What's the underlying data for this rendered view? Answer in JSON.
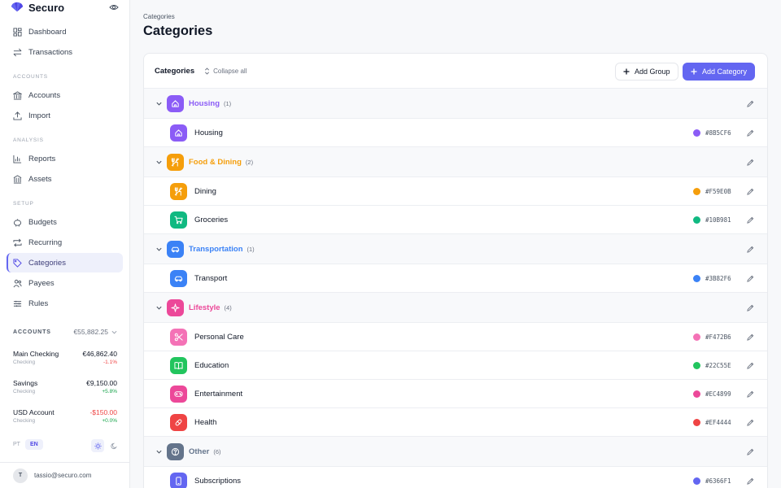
{
  "app": {
    "name": "Securo",
    "brand_color": "#6366f1"
  },
  "nav": {
    "top": [
      {
        "label": "Dashboard",
        "icon": "dashboard-icon"
      },
      {
        "label": "Transactions",
        "icon": "transactions-icon"
      }
    ],
    "accounts_label": "ACCOUNTS",
    "accounts": [
      {
        "label": "Accounts",
        "icon": "bank-icon"
      },
      {
        "label": "Import",
        "icon": "upload-icon"
      }
    ],
    "analysis_label": "ANALYSIS",
    "analysis": [
      {
        "label": "Reports",
        "icon": "chart-icon"
      },
      {
        "label": "Assets",
        "icon": "building-icon"
      }
    ],
    "setup_label": "SETUP",
    "setup": [
      {
        "label": "Budgets",
        "icon": "piggy-icon"
      },
      {
        "label": "Recurring",
        "icon": "repeat-icon"
      },
      {
        "label": "Categories",
        "icon": "tag-icon",
        "active": true
      },
      {
        "label": "Payees",
        "icon": "people-icon"
      },
      {
        "label": "Rules",
        "icon": "sliders-icon"
      }
    ]
  },
  "accounts_summary": {
    "label": "ACCOUNTS",
    "total": "€55,882.25",
    "items": [
      {
        "name": "Main Checking",
        "type": "Checking",
        "balance": "€46,862.40",
        "change": "-1.1%",
        "trend": "neg"
      },
      {
        "name": "Savings",
        "type": "Checking",
        "balance": "€9,150.00",
        "change": "+5.8%",
        "trend": "pos"
      },
      {
        "name": "USD Account",
        "type": "Checking",
        "balance": "-$150.00",
        "change": "+0.0%",
        "trend": "pos"
      }
    ]
  },
  "language": {
    "options": [
      "PT",
      "EN"
    ],
    "selected": "EN"
  },
  "user": {
    "initial": "T",
    "email": "tassio@securo.com"
  },
  "page": {
    "breadcrumb": "Categories",
    "title": "Categories"
  },
  "toolbar": {
    "title": "Categories",
    "collapse_label": "Collapse all",
    "add_group_label": "Add Group",
    "add_category_label": "Add Category"
  },
  "groups": [
    {
      "name": "Housing",
      "count": "(1)",
      "color": "#8B5CF6",
      "icon": "home-icon",
      "items": [
        {
          "name": "Housing",
          "hex": "#8B5CF6",
          "icon": "home-icon"
        }
      ]
    },
    {
      "name": "Food & Dining",
      "count": "(2)",
      "color": "#F59E0B",
      "icon": "utensils-icon",
      "items": [
        {
          "name": "Dining",
          "hex": "#F59E0B",
          "icon": "utensils-icon"
        },
        {
          "name": "Groceries",
          "hex": "#10B981",
          "icon": "cart-icon"
        }
      ]
    },
    {
      "name": "Transportation",
      "count": "(1)",
      "color": "#3B82F6",
      "icon": "car-icon",
      "items": [
        {
          "name": "Transport",
          "hex": "#3B82F6",
          "icon": "car-icon"
        }
      ]
    },
    {
      "name": "Lifestyle",
      "count": "(4)",
      "color": "#EC4899",
      "icon": "sparkles-icon",
      "items": [
        {
          "name": "Personal Care",
          "hex": "#F472B6",
          "icon": "scissors-icon"
        },
        {
          "name": "Education",
          "hex": "#22C55E",
          "icon": "book-icon"
        },
        {
          "name": "Entertainment",
          "hex": "#EC4899",
          "icon": "gamepad-icon"
        },
        {
          "name": "Health",
          "hex": "#EF4444",
          "icon": "pill-icon"
        }
      ]
    },
    {
      "name": "Other",
      "count": "(6)",
      "color": "#64748B",
      "icon": "help-circle-icon",
      "items": [
        {
          "name": "Subscriptions",
          "hex": "#6366F1",
          "icon": "phone-icon"
        }
      ]
    }
  ]
}
